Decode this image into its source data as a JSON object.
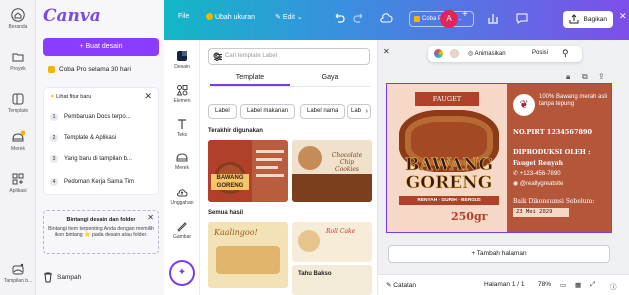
{
  "rail": {
    "items": [
      {
        "label": "Beranda",
        "icon": "home-icon"
      },
      {
        "label": "Proyek",
        "icon": "folder-icon"
      },
      {
        "label": "Template",
        "icon": "template-icon"
      },
      {
        "label": "Merek",
        "icon": "brand-icon"
      },
      {
        "label": "Aplikasi",
        "icon": "apps-icon"
      },
      {
        "label": "Tampilan b...",
        "icon": "sparkle-icon"
      }
    ]
  },
  "sidebar": {
    "logo": "Canva",
    "create_button": "+  Buat desain",
    "pro_trial": "Coba Pro selama 30 hari",
    "whats_new": {
      "title": "Lihat fitur baru",
      "steps": [
        {
          "num": "1",
          "label": "Pembaruan Docs terpo..."
        },
        {
          "num": "2",
          "label": "Template & Aplikasi"
        },
        {
          "num": "3",
          "label": "Yang baru di tampilan b..."
        },
        {
          "num": "4",
          "label": "Pedoman Kerja Sama Tim"
        }
      ]
    },
    "promo": {
      "title": "Bintangi desain dan folder",
      "body": "Bintangi item terpenting Anda dengan memilih ikon bintang ⭐ pada desain atau folder."
    },
    "trash": "Sampah"
  },
  "topbar": {
    "file": "File",
    "resize": "Ubah ukuran",
    "edit": "Edit",
    "pro_pill": "Coba Pro sel...",
    "avatar_initial": "A",
    "share": "Bagikan"
  },
  "icons_column": [
    {
      "label": "Desain"
    },
    {
      "label": "Elemen"
    },
    {
      "label": "Teks"
    },
    {
      "label": "Merek"
    },
    {
      "label": "Unggahan"
    },
    {
      "label": "Gambar"
    }
  ],
  "panel": {
    "search_placeholder": "Cari template Label",
    "tabs": [
      "Template",
      "Gaya"
    ],
    "chips": [
      "Label",
      "Label makanan",
      "Label nama",
      "Lab"
    ],
    "recent_heading": "Terakhir digunakan",
    "all_heading": "Semua hasil",
    "thumb_texts": [
      "BAWANG GORENG",
      "Chocolate Chip Cookies",
      "Kaalingoo!",
      "Roll Cake",
      "Tahu Bakso"
    ]
  },
  "canvas": {
    "toolbar": {
      "animate": "Animasikan",
      "position": "Posisi"
    },
    "design": {
      "brand": "FAUGET",
      "product_line1": "BAWANG",
      "product_line2": "GORENG",
      "tagline": "RENYAH - GURIH - BERGIZI",
      "weight": "250gr",
      "badge": "100% Bawang merah asli tanpa tepung",
      "pirt": "NO.PIRT 1234567890",
      "produced_by_title": "DIPRODUKSI OLEH :",
      "producer": "Fauget Renyah",
      "phone": "+123-456-7890",
      "instagram": "@reallygreatsite",
      "best_before_title": "Baik Dikonsumsi Sebelum:",
      "best_before_date": "23 Mei 2029"
    },
    "add_page": "+ Tambah halaman",
    "bottombar": {
      "notes": "Catatan",
      "page": "Halaman 1 / 1",
      "zoom": "78%"
    }
  }
}
